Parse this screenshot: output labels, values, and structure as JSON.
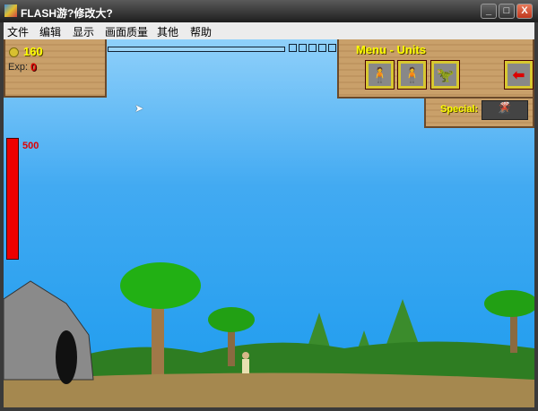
{
  "window": {
    "title": "FLASH游?修改大?",
    "buttons": {
      "minimize": "_",
      "maximize": "□",
      "close": "X"
    }
  },
  "menubar": {
    "items": [
      "文件",
      "编辑",
      "显示",
      "画面质量",
      "其他",
      "帮助"
    ]
  },
  "hud": {
    "gold": "160",
    "exp_label": "Exp:",
    "exp_value": "0",
    "progress_slots": 5
  },
  "units_menu": {
    "title": "Menu - Units",
    "units": [
      "caveman-club",
      "caveman-slingshot",
      "dino-rider"
    ],
    "back_icon": "red-arrow-left"
  },
  "special": {
    "label": "Special:",
    "icon": "volcano-meteor"
  },
  "base": {
    "health": "500"
  }
}
